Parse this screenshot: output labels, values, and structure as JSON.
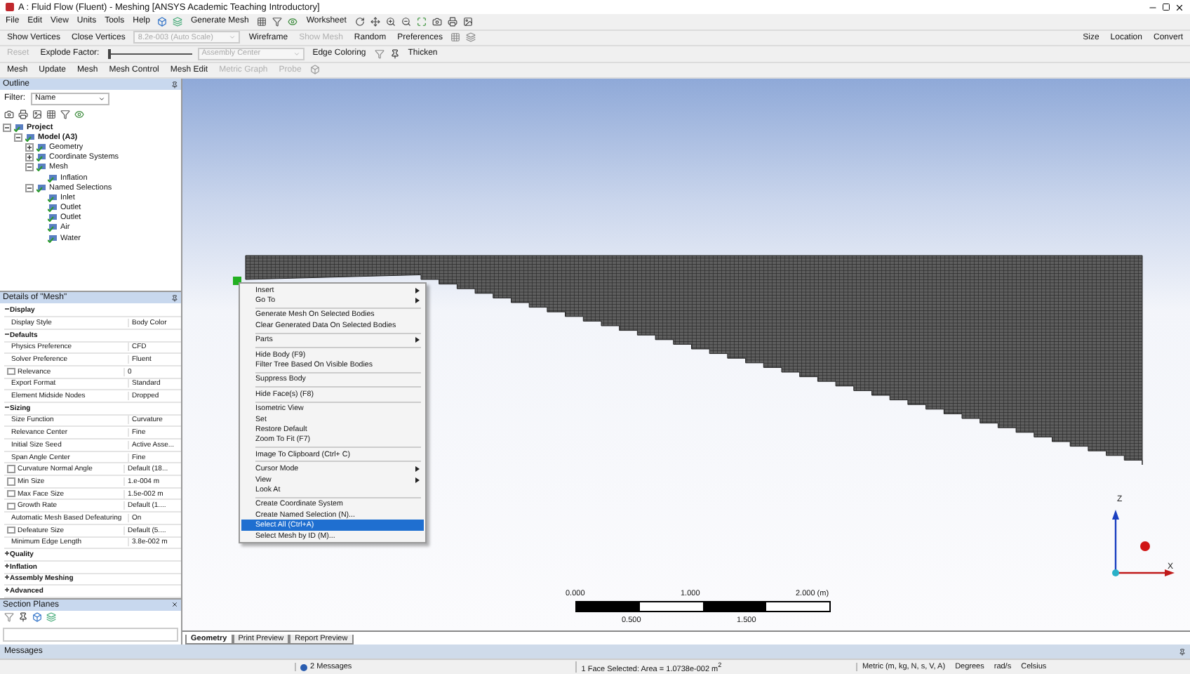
{
  "window": {
    "title": "A : Fluid Flow (Fluent) - Meshing [ANSYS Academic Teaching Introductory]"
  },
  "menu": [
    "File",
    "Edit",
    "View",
    "Units",
    "Tools",
    "Help"
  ],
  "toolbar_rows": [
    [
      {
        "kind": "icons"
      },
      {
        "kind": "button",
        "label": "Generate Mesh",
        "disabled": false
      },
      {
        "kind": "icons"
      },
      {
        "kind": "button",
        "label": "Worksheet",
        "disabled": false
      },
      {
        "kind": "icons"
      },
      {
        "kind": "icons"
      }
    ],
    [
      {
        "kind": "button",
        "label": "Show Vertices",
        "disabled": false
      },
      {
        "kind": "button",
        "label": "Close Vertices",
        "disabled": false
      },
      {
        "kind": "dropdown",
        "label": "8.2e-003 (Auto Scale)",
        "disabled": true
      },
      {
        "kind": "button",
        "label": "Wireframe",
        "disabled": false
      },
      {
        "kind": "button",
        "label": "Show Mesh",
        "disabled": true
      },
      {
        "kind": "button",
        "label": "Random",
        "disabled": false
      },
      {
        "kind": "button",
        "label": "Preferences",
        "disabled": false
      },
      {
        "kind": "icons"
      },
      {
        "kind": "spacer"
      },
      {
        "kind": "button",
        "label": "Size",
        "disabled": false
      },
      {
        "kind": "button",
        "label": "Location",
        "disabled": false
      },
      {
        "kind": "button",
        "label": "Convert",
        "disabled": false
      }
    ],
    [
      {
        "kind": "button",
        "label": "Reset",
        "disabled": true
      },
      {
        "kind": "label",
        "label": "Explode Factor:",
        "disabled": false
      },
      {
        "kind": "slider"
      },
      {
        "kind": "dropdown",
        "label": "Assembly Center",
        "disabled": true
      },
      {
        "kind": "button",
        "label": "Edge Coloring",
        "disabled": false
      },
      {
        "kind": "icons"
      },
      {
        "kind": "button",
        "label": "Thicken",
        "disabled": false
      }
    ],
    [
      {
        "kind": "label",
        "label": "Mesh",
        "disabled": false
      },
      {
        "kind": "button",
        "label": "Update",
        "disabled": false
      },
      {
        "kind": "button",
        "label": "Mesh",
        "disabled": false
      },
      {
        "kind": "button",
        "label": "Mesh Control",
        "disabled": false
      },
      {
        "kind": "button",
        "label": "Mesh Edit",
        "disabled": false
      },
      {
        "kind": "button",
        "label": "Metric Graph",
        "disabled": true
      },
      {
        "kind": "button",
        "label": "Probe",
        "disabled": true
      },
      {
        "kind": "icons"
      }
    ]
  ],
  "outline": {
    "title": "Outline",
    "filter_label": "Filter:",
    "filter_value": "Name",
    "tree": [
      {
        "label": "Project",
        "expanded": true,
        "children": [
          {
            "label": "Model (A3)",
            "expanded": true,
            "children": [
              {
                "label": "Geometry",
                "expanded": false
              },
              {
                "label": "Coordinate Systems",
                "expanded": false
              },
              {
                "label": "Mesh",
                "expanded": true,
                "children": [
                  {
                    "label": "Inflation"
                  }
                ]
              },
              {
                "label": "Named Selections",
                "expanded": true,
                "children": [
                  {
                    "label": "Inlet"
                  },
                  {
                    "label": "Outlet"
                  },
                  {
                    "label": "Outlet"
                  },
                  {
                    "label": "Air"
                  },
                  {
                    "label": "Water"
                  }
                ]
              }
            ]
          }
        ]
      }
    ]
  },
  "details": {
    "title": "Details of \"Mesh\"",
    "rows": [
      {
        "kind": "header",
        "label": "Display",
        "expanded": true
      },
      {
        "kind": "param",
        "label": "Display Style",
        "value": "Body Color"
      },
      {
        "kind": "header",
        "label": "Defaults",
        "expanded": true
      },
      {
        "kind": "param",
        "label": "Physics Preference",
        "value": "CFD"
      },
      {
        "kind": "param",
        "label": "Solver Preference",
        "value": "Fluent"
      },
      {
        "kind": "check_param",
        "label": "Relevance",
        "value": "0",
        "checked": false
      },
      {
        "kind": "param",
        "label": "Export Format",
        "value": "Standard"
      },
      {
        "kind": "param",
        "label": "Element Midside Nodes",
        "value": "Dropped"
      },
      {
        "kind": "header",
        "label": "Sizing",
        "expanded": true
      },
      {
        "kind": "param",
        "label": "Size Function",
        "value": "Curvature"
      },
      {
        "kind": "param",
        "label": "Relevance Center",
        "value": "Fine"
      },
      {
        "kind": "param",
        "label": "Initial Size Seed",
        "value": "Active Asse..."
      },
      {
        "kind": "param",
        "label": "Span Angle Center",
        "value": "Fine"
      },
      {
        "kind": "check_param",
        "label": "Curvature Normal Angle",
        "value": "Default (18...",
        "checked": false
      },
      {
        "kind": "check_param",
        "label": "Min Size",
        "value": "1.e-004 m",
        "checked": false
      },
      {
        "kind": "check_param",
        "label": "Max Face Size",
        "value": "1.5e-002 m",
        "checked": false
      },
      {
        "kind": "check_param",
        "label": "Growth Rate",
        "value": "Default (1....",
        "checked": false
      },
      {
        "kind": "param",
        "label": "Automatic Mesh Based Defeaturing",
        "value": "On"
      },
      {
        "kind": "check_param",
        "label": "Defeature Size",
        "value": "Default (5....",
        "checked": false
      },
      {
        "kind": "param",
        "label": "Minimum Edge Length",
        "value": "3.8e-002 m"
      },
      {
        "kind": "header",
        "label": "Quality",
        "expanded": false
      },
      {
        "kind": "header",
        "label": "Inflation",
        "expanded": false
      },
      {
        "kind": "header",
        "label": "Assembly Meshing",
        "expanded": false
      },
      {
        "kind": "header",
        "label": "Advanced",
        "expanded": false
      }
    ]
  },
  "section_planes": {
    "title": "Section Planes"
  },
  "context_menu": [
    {
      "kind": "item",
      "label": "Insert",
      "submenu": true,
      "selected": false
    },
    {
      "kind": "item",
      "label": "Go To",
      "submenu": true,
      "selected": false
    },
    {
      "kind": "separator"
    },
    {
      "kind": "item",
      "label": "Generate Mesh On Selected Bodies",
      "submenu": false,
      "selected": false
    },
    {
      "kind": "item",
      "label": "Clear Generated Data On Selected Bodies",
      "submenu": false,
      "selected": false
    },
    {
      "kind": "separator"
    },
    {
      "kind": "item",
      "label": "Parts",
      "submenu": true,
      "selected": false
    },
    {
      "kind": "separator"
    },
    {
      "kind": "item",
      "label": "Hide Body (F9)",
      "submenu": false,
      "selected": false
    },
    {
      "kind": "item",
      "label": "Filter Tree Based On Visible Bodies",
      "submenu": false,
      "selected": false
    },
    {
      "kind": "separator"
    },
    {
      "kind": "item",
      "label": "Suppress Body",
      "submenu": false,
      "selected": false
    },
    {
      "kind": "separator"
    },
    {
      "kind": "item",
      "label": "Hide Face(s) (F8)",
      "submenu": false,
      "selected": false
    },
    {
      "kind": "separator"
    },
    {
      "kind": "item",
      "label": "Isometric View",
      "submenu": false,
      "selected": false
    },
    {
      "kind": "item",
      "label": "Set",
      "submenu": false,
      "selected": false
    },
    {
      "kind": "item",
      "label": "Restore Default",
      "submenu": false,
      "selected": false
    },
    {
      "kind": "item",
      "label": "Zoom To Fit (F7)",
      "submenu": false,
      "selected": false
    },
    {
      "kind": "separator"
    },
    {
      "kind": "item",
      "label": "Image To Clipboard (Ctrl+ C)",
      "submenu": false,
      "selected": false
    },
    {
      "kind": "separator"
    },
    {
      "kind": "item",
      "label": "Cursor Mode",
      "submenu": true,
      "selected": false
    },
    {
      "kind": "item",
      "label": "View",
      "submenu": true,
      "selected": false
    },
    {
      "kind": "item",
      "label": "Look At",
      "submenu": false,
      "selected": false
    },
    {
      "kind": "separator"
    },
    {
      "kind": "item",
      "label": "Create Coordinate System",
      "submenu": false,
      "selected": false
    },
    {
      "kind": "item",
      "label": "Create Named Selection (N)...",
      "submenu": false,
      "selected": false
    },
    {
      "kind": "item",
      "label": "Select All (Ctrl+A)",
      "submenu": false,
      "selected": true
    },
    {
      "kind": "item",
      "label": "Select Mesh by ID (M)...",
      "submenu": false,
      "selected": false
    }
  ],
  "scale_bar": {
    "top_labels": [
      "0.000",
      "1.000",
      "2.000 (m)"
    ],
    "bottom_labels": [
      "0.500",
      "1.500"
    ]
  },
  "triad": {
    "axes": [
      "Z",
      "X"
    ]
  },
  "view_tabs": [
    {
      "label": "Geometry",
      "selected": true
    },
    {
      "label": "Print Preview",
      "selected": false
    },
    {
      "label": "Report Preview",
      "selected": false
    }
  ],
  "messages_title": "Messages",
  "status_bar": {
    "messages": "2 Messages",
    "selection": "1 Face Selected: Area = 1.0738e-002 m$^{2}$",
    "units": [
      "Metric (m, kg, N, s, V, A)",
      "Degrees",
      "rad/s",
      "Celsius"
    ]
  }
}
